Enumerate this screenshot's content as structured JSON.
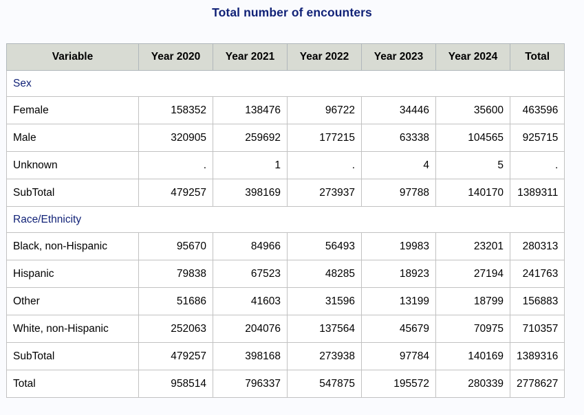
{
  "title": "Total number of encounters",
  "columns": [
    "Variable",
    "Year 2020",
    "Year 2021",
    "Year 2022",
    "Year 2023",
    "Year 2024",
    "Total"
  ],
  "rows": [
    {
      "type": "group",
      "label": "Sex"
    },
    {
      "type": "data",
      "label": "Female",
      "values": [
        "158352",
        "138476",
        "96722",
        "34446",
        "35600",
        "463596"
      ]
    },
    {
      "type": "data",
      "label": "Male",
      "values": [
        "320905",
        "259692",
        "177215",
        "63338",
        "104565",
        "925715"
      ]
    },
    {
      "type": "data",
      "label": "Unknown",
      "values": [
        ".",
        "1",
        ".",
        "4",
        "5",
        "."
      ]
    },
    {
      "type": "data",
      "label": "SubTotal",
      "values": [
        "479257",
        "398169",
        "273937",
        "97788",
        "140170",
        "1389311"
      ]
    },
    {
      "type": "group",
      "label": "Race/Ethnicity"
    },
    {
      "type": "data",
      "label": "Black, non-Hispanic",
      "values": [
        "95670",
        "84966",
        "56493",
        "19983",
        "23201",
        "280313"
      ]
    },
    {
      "type": "data",
      "label": "Hispanic",
      "values": [
        "79838",
        "67523",
        "48285",
        "18923",
        "27194",
        "241763"
      ]
    },
    {
      "type": "data",
      "label": "Other",
      "values": [
        "51686",
        "41603",
        "31596",
        "13199",
        "18799",
        "156883"
      ]
    },
    {
      "type": "data",
      "label": "White, non-Hispanic",
      "values": [
        "252063",
        "204076",
        "137564",
        "45679",
        "70975",
        "710357"
      ]
    },
    {
      "type": "data",
      "label": "SubTotal",
      "values": [
        "479257",
        "398168",
        "273938",
        "97784",
        "140169",
        "1389316"
      ]
    },
    {
      "type": "data",
      "label": "Total",
      "values": [
        "958514",
        "796337",
        "547875",
        "195572",
        "280339",
        "2778627"
      ]
    }
  ],
  "colors": {
    "title": "#112277",
    "header_bg": "#d8dbd3",
    "group_text": "#112277",
    "border": "#c1c1c1",
    "page_bg": "#fafbfe"
  }
}
